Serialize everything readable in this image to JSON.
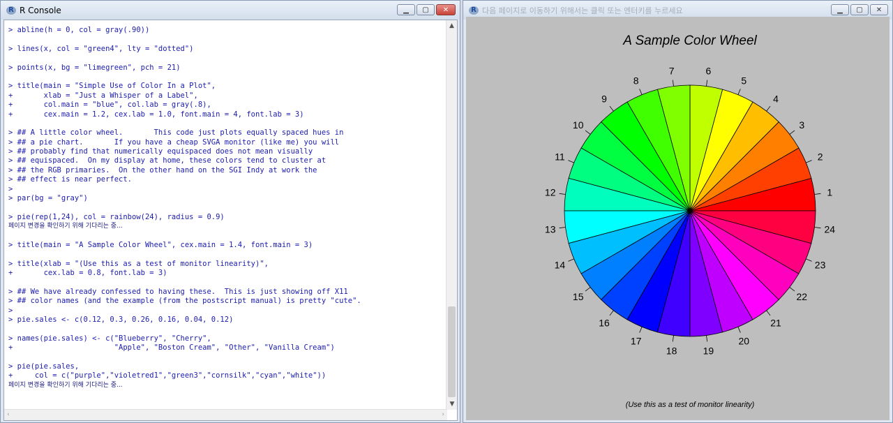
{
  "console": {
    "title": "R Console",
    "lines": [
      "> abline(h = 0, col = gray(.90))",
      "",
      "> lines(x, col = \"green4\", lty = \"dotted\")",
      "",
      "> points(x, bg = \"limegreen\", pch = 21)",
      "",
      "> title(main = \"Simple Use of Color In a Plot\",",
      "+       xlab = \"Just a Whisper of a Label\",",
      "+       col.main = \"blue\", col.lab = gray(.8),",
      "+       cex.main = 1.2, cex.lab = 1.0, font.main = 4, font.lab = 3)",
      "",
      "> ## A little color wheel.       This code just plots equally spaced hues in",
      "> ## a pie chart.       If you have a cheap SVGA monitor (like me) you will",
      "> ## probably find that numerically equispaced does not mean visually",
      "> ## equispaced.  On my display at home, these colors tend to cluster at",
      "> ## the RGB primaries.  On the other hand on the SGI Indy at work the",
      "> ## effect is near perfect.",
      ">",
      "> par(bg = \"gray\")",
      "",
      "> pie(rep(1,24), col = rainbow(24), radius = 0.9)",
      "페이지 변경을 확인하기 위해 기다리는 중...",
      "",
      "> title(main = \"A Sample Color Wheel\", cex.main = 1.4, font.main = 3)",
      "",
      "> title(xlab = \"(Use this as a test of monitor linearity)\",",
      "+       cex.lab = 0.8, font.lab = 3)",
      "",
      "> ## We have already confessed to having these.  This is just showing off X11",
      "> ## color names (and the example (from the postscript manual) is pretty \"cute\".",
      ">",
      "> pie.sales <- c(0.12, 0.3, 0.26, 0.16, 0.04, 0.12)",
      "",
      "> names(pie.sales) <- c(\"Blueberry\", \"Cherry\",",
      "+                       \"Apple\", \"Boston Cream\", \"Other\", \"Vanilla Cream\")",
      "",
      "> pie(pie.sales,",
      "+     col = c(\"purple\",\"violetred1\",\"green3\",\"cornsilk\",\"cyan\",\"white\"))",
      "페이지 변경을 확인하기 위해 기다리는 중..."
    ]
  },
  "graphics": {
    "title": "다음 페이지로 이동하기 위해서는 클릭 또는 엔터키를 누르세요",
    "background": "#bebebe"
  },
  "chart_data": {
    "type": "pie",
    "title": "A Sample Color Wheel",
    "xlabel": "(Use this as a test of monitor linearity)",
    "categories": [
      "1",
      "2",
      "3",
      "4",
      "5",
      "6",
      "7",
      "8",
      "9",
      "10",
      "11",
      "12",
      "13",
      "14",
      "15",
      "16",
      "17",
      "18",
      "19",
      "20",
      "21",
      "22",
      "23",
      "24"
    ],
    "values": [
      1,
      1,
      1,
      1,
      1,
      1,
      1,
      1,
      1,
      1,
      1,
      1,
      1,
      1,
      1,
      1,
      1,
      1,
      1,
      1,
      1,
      1,
      1,
      1
    ],
    "colors": [
      "#FF0000",
      "#FF4000",
      "#FF8000",
      "#FFBF00",
      "#FFFF00",
      "#BFFF00",
      "#80FF00",
      "#40FF00",
      "#00FF00",
      "#00FF40",
      "#00FF80",
      "#00FFBF",
      "#00FFFF",
      "#00BFFF",
      "#0080FF",
      "#0040FF",
      "#0000FF",
      "#4000FF",
      "#8000FF",
      "#BF00FF",
      "#FF00FF",
      "#FF00BF",
      "#FF0080",
      "#FF0040"
    ],
    "start_angle_deg": 0,
    "direction": "counterclockwise",
    "radius": 0.9
  }
}
